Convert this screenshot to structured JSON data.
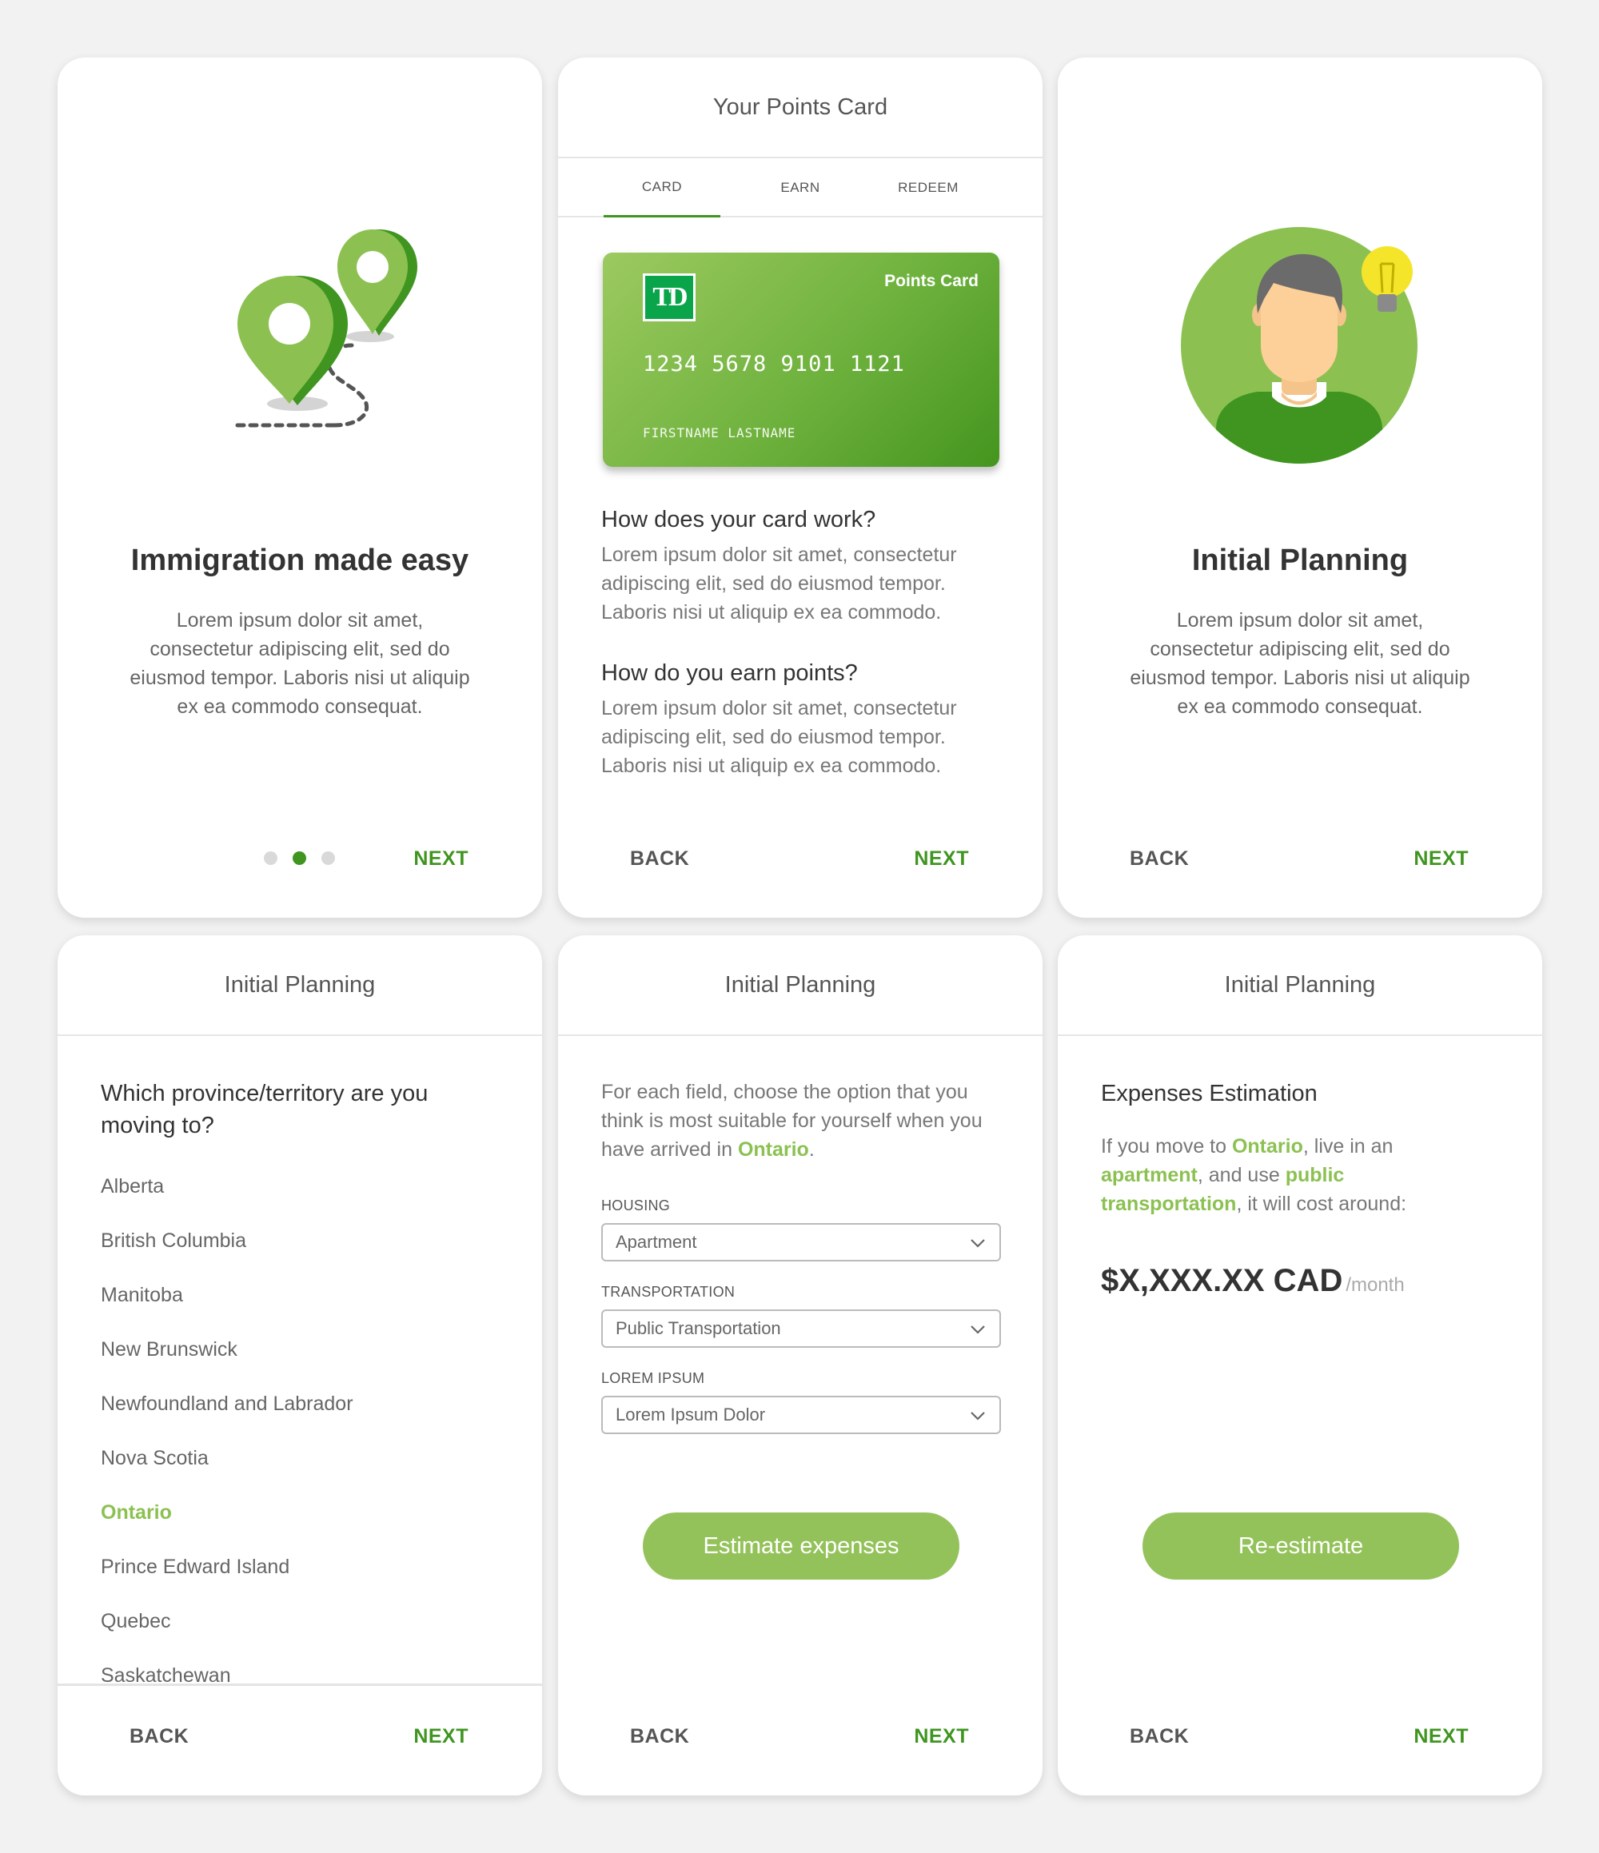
{
  "card1": {
    "title": "Immigration made easy",
    "desc": "Lorem ipsum dolor sit amet, consectetur adipiscing elit, sed do eiusmod tempor. Laboris nisi ut aliquip ex ea commodo consequat.",
    "next": "NEXT",
    "pagination": {
      "count": 3,
      "active": 2
    }
  },
  "card2": {
    "header": "Your Points Card",
    "tabs": [
      "CARD",
      "EARN",
      "REDEEM"
    ],
    "active_tab": "CARD",
    "card": {
      "label": "Points Card",
      "logo": "TD",
      "number": "1234 5678 9101 1121",
      "name": "FIRSTNAME LASTNAME"
    },
    "q1_title": "How does your card work?",
    "q1_body": "Lorem ipsum dolor sit amet, consectetur adipiscing elit, sed do eiusmod tempor. Laboris nisi ut aliquip ex ea commodo.",
    "q2_title": "How do you earn points?",
    "q2_body": "Lorem ipsum dolor sit amet, consectetur adipiscing elit, sed do eiusmod tempor. Laboris nisi ut aliquip ex ea commodo.",
    "back": "BACK",
    "next": "NEXT"
  },
  "card3": {
    "title": "Initial Planning",
    "desc": "Lorem ipsum dolor sit amet, consectetur adipiscing elit, sed do eiusmod tempor. Laboris nisi ut aliquip ex ea commodo consequat.",
    "back": "BACK",
    "next": "NEXT"
  },
  "card4": {
    "header": "Initial Planning",
    "question": "Which province/territory are you moving to?",
    "provinces": [
      "Alberta",
      "British Columbia",
      "Manitoba",
      "New Brunswick",
      "Newfoundland and Labrador",
      "Nova Scotia",
      "Ontario",
      "Prince Edward Island",
      "Quebec",
      "Saskatchewan"
    ],
    "selected": "Ontario",
    "back": "BACK",
    "next": "NEXT"
  },
  "card5": {
    "header": "Initial Planning",
    "intro_a": "For each field, choose the option that you think is most suitable for yourself when you have arrived in ",
    "intro_b": "Ontario",
    "intro_c": ".",
    "fields": [
      {
        "label": "HOUSING",
        "value": "Apartment"
      },
      {
        "label": "TRANSPORTATION",
        "value": "Public Transportation"
      },
      {
        "label": "LOREM IPSUM",
        "value": "Lorem Ipsum Dolor"
      }
    ],
    "button": "Estimate expenses",
    "back": "BACK",
    "next": "NEXT"
  },
  "card6": {
    "header": "Initial Planning",
    "title": "Expenses Estimation",
    "t1": "If you move to ",
    "h1": "Ontario",
    "t2": ", live in an ",
    "h2": "apartment",
    "t3": ", and use ",
    "h3": "public transportation",
    "t4": ", it will cost around:",
    "cost": "$X,XXX.XX CAD",
    "per": "/month",
    "button": "Re-estimate",
    "back": "BACK",
    "next": "NEXT"
  },
  "colors": {
    "primary_green": "#3f9520",
    "light_green": "#8cc152",
    "button_green": "#94c25a",
    "background": "#f2f2f2"
  }
}
